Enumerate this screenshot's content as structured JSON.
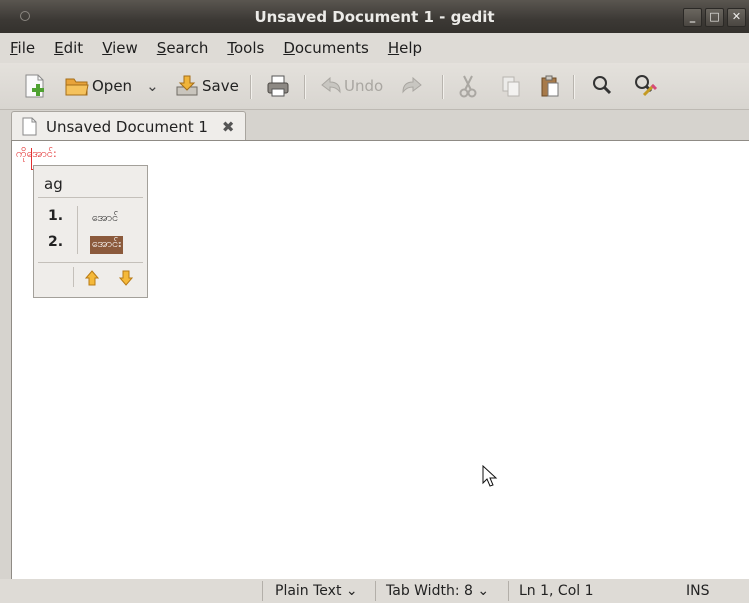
{
  "window": {
    "title": "Unsaved Document 1 - gedit",
    "buttons": [
      "_",
      "□",
      "✕"
    ]
  },
  "menu": [
    {
      "mnemonic": "F",
      "rest": "ile"
    },
    {
      "mnemonic": "E",
      "rest": "dit"
    },
    {
      "mnemonic": "V",
      "rest": "iew"
    },
    {
      "mnemonic": "S",
      "rest": "earch"
    },
    {
      "mnemonic": "T",
      "rest": "ools"
    },
    {
      "mnemonic": "D",
      "rest": "ocuments"
    },
    {
      "mnemonic": "H",
      "rest": "elp"
    }
  ],
  "toolbar": {
    "open_label": "Open",
    "save_label": "Save",
    "undo_label": "Undo",
    "dropdown_glyph": "⌄"
  },
  "tab": {
    "label": "Unsaved Document 1",
    "close": "✖"
  },
  "editor": {
    "text": "ကိုအောင်:"
  },
  "ime": {
    "code": "ag",
    "candidates": [
      {
        "num": "1.",
        "text": "အောင်",
        "selected": false
      },
      {
        "num": "2.",
        "text": "အောင်း",
        "selected": true
      }
    ]
  },
  "status": {
    "language": "Plain Text ⌄",
    "tab_width": "Tab Width:  8 ⌄",
    "position": "Ln 1, Col 1",
    "mode": "INS"
  },
  "colors": {
    "titlebar": "#3c3935",
    "accent_red": "#e23030",
    "selection": "#8b5a3c"
  }
}
